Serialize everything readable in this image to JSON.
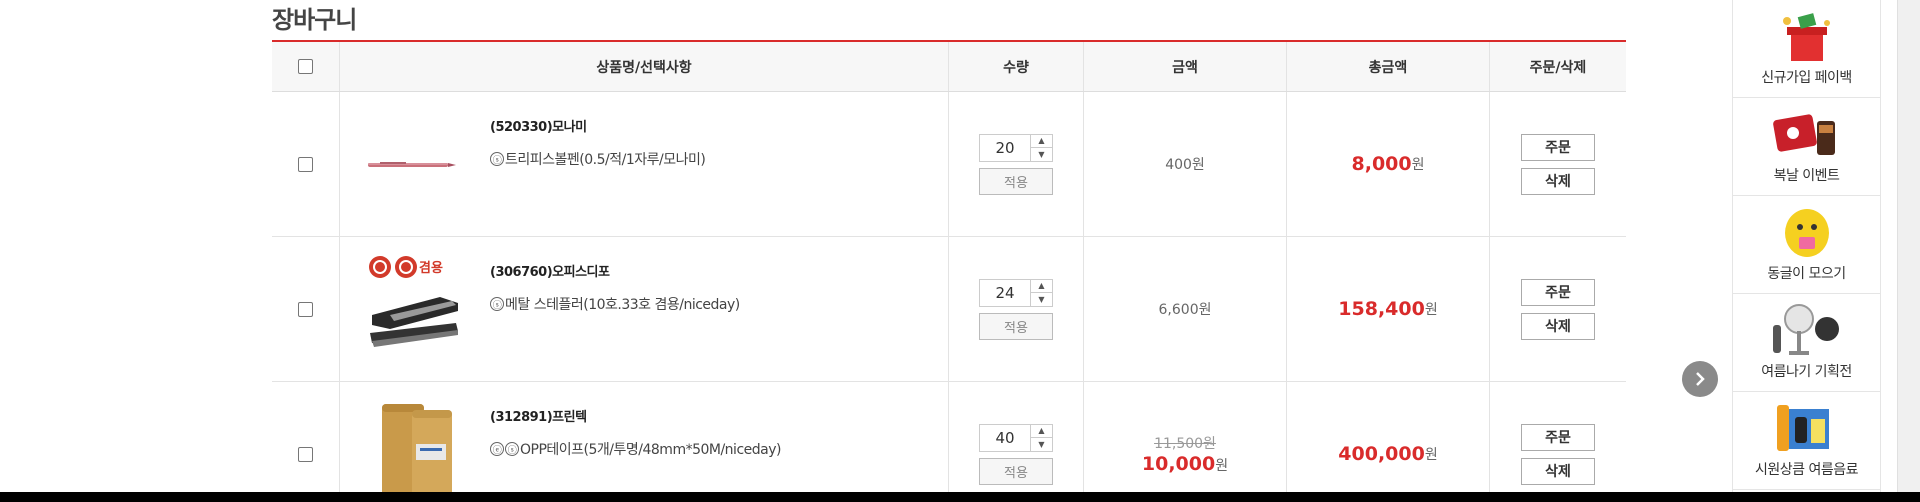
{
  "page": {
    "title": "장바구니"
  },
  "header": {
    "product": "상품명/선택사항",
    "qty": "수량",
    "price": "금액",
    "total": "총금액",
    "action": "주문/삭제"
  },
  "items": [
    {
      "name": "(520330)모나미",
      "badges": [
        "ⓢ"
      ],
      "option": "트리피스볼펜(0.5/적/1자루/모나미)",
      "qty": "20",
      "apply": "적용",
      "price_old": "",
      "price": "400원",
      "price_won": "",
      "total": "8,000",
      "total_won": "원",
      "order": "주문",
      "delete": "삭제"
    },
    {
      "name": "(306760)오피스디포",
      "badges": [
        "ⓢ"
      ],
      "option": "메탈 스테플러(10호.33호 겸용/niceday)",
      "qty": "24",
      "apply": "적용",
      "price_old": "",
      "price": "6,600원",
      "price_won": "",
      "total": "158,400",
      "total_won": "원",
      "order": "주문",
      "delete": "삭제"
    },
    {
      "name": "(312891)프린텍",
      "badges": [
        "ⓔ",
        "ⓢ"
      ],
      "option": "OPP테이프(5개/투명/48mm*50M/niceday)",
      "qty": "40",
      "apply": "적용",
      "price_old": "11,500원",
      "price": "10,000",
      "price_won": "원",
      "total": "400,000",
      "total_won": "원",
      "order": "주문",
      "delete": "삭제"
    }
  ],
  "stapler_badge": "겸용",
  "sidebar": [
    {
      "label": "신규가입 페이백",
      "icon": "gift-box-icon"
    },
    {
      "label": "복날 이벤트",
      "icon": "event-card-icon"
    },
    {
      "label": "동글이 모으기",
      "icon": "character-icon"
    },
    {
      "label": "여름나기 기획전",
      "icon": "fan-icon"
    },
    {
      "label": "시원상큼 여름음료",
      "icon": "drinks-icon"
    }
  ],
  "colors": {
    "accent": "#d92b2b"
  }
}
